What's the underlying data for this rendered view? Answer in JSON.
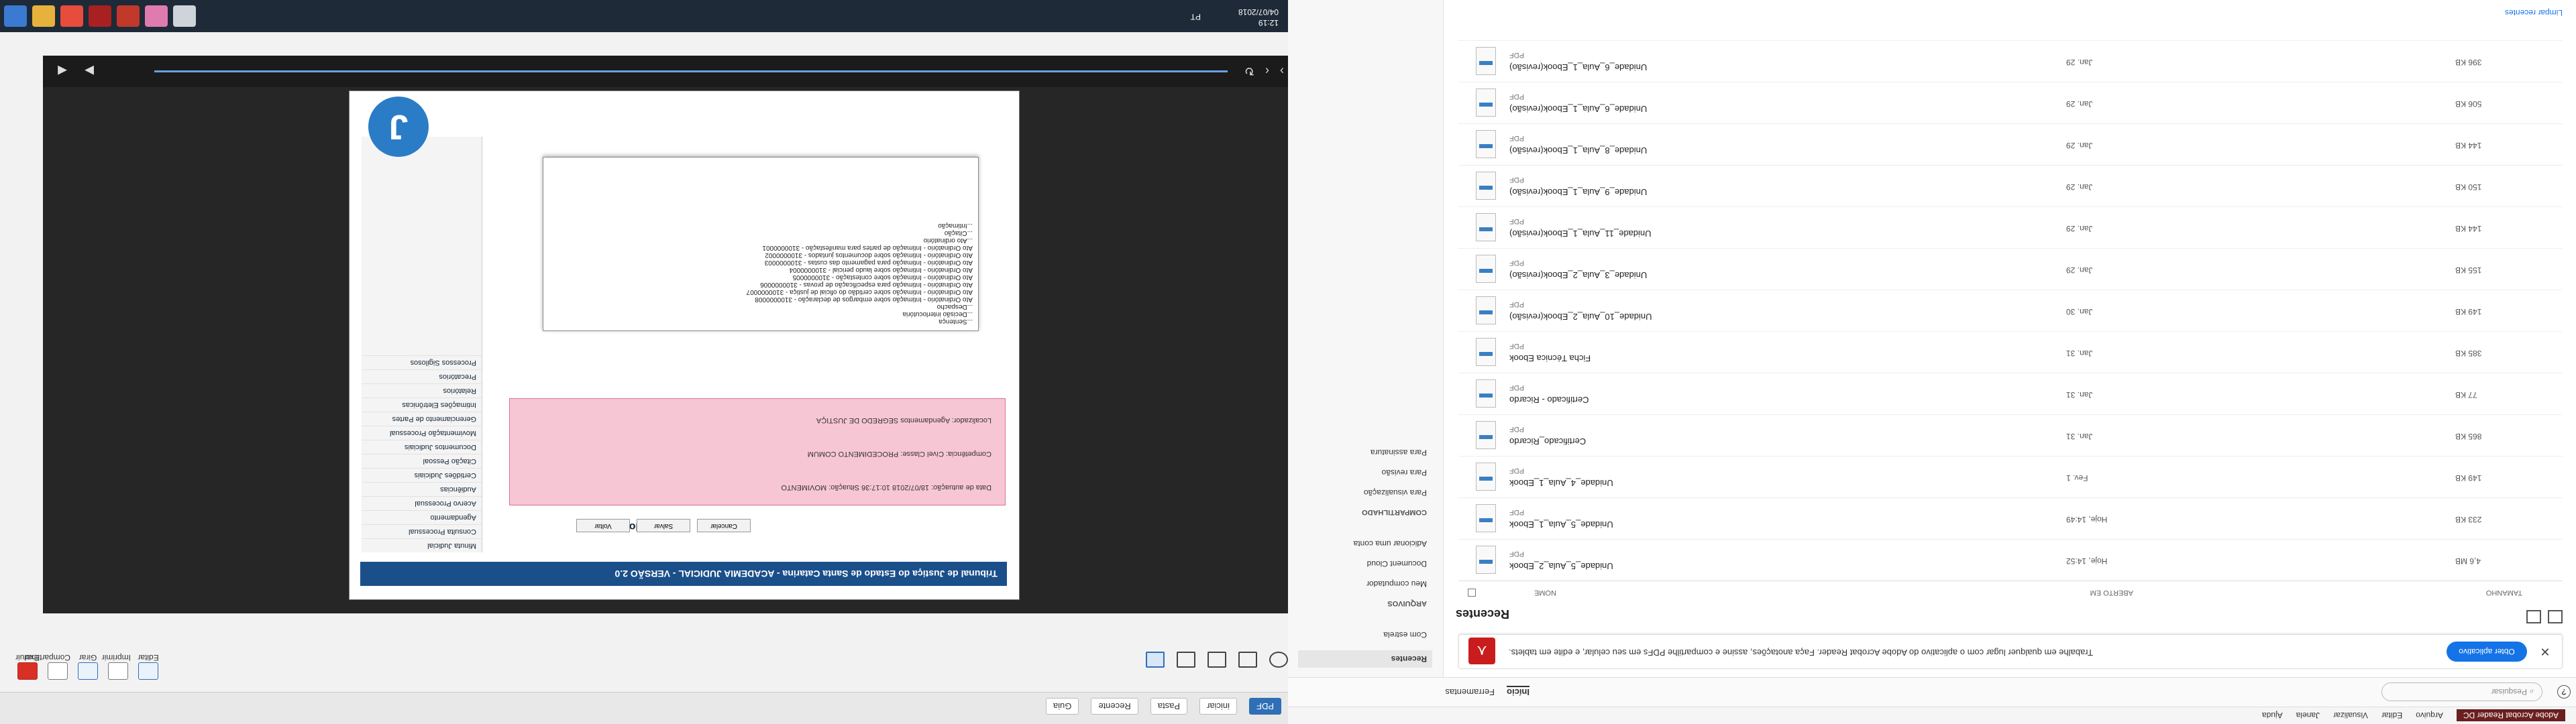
{
  "left": {
    "taskbar": {
      "time": "12:19",
      "date": "04/07/2018",
      "lang": "PT"
    },
    "tabs": [
      "PDF",
      "iniciar",
      "Pasta",
      "Recente",
      "Guia"
    ],
    "tools": [
      "Excluir",
      "Compartilhar",
      "Girar",
      "Imprimir",
      "Editar"
    ],
    "doc": {
      "header": "Tribunal de Justiça do Estado de Santa Catarina - ACADEMIA JUDICIAL - VERSÃO 2.0",
      "title": "Nova Minuta",
      "badge": "J",
      "pink_lines": [
        "Localizador: Agendamentos  SEGREDO DE JUSTIÇA",
        "Competência: Cível   Classe: PROCEDIMENTO COMUM",
        "Data de autuação: 18/07/2018 10:17:36   Situação: MOVIMENTO"
      ],
      "buttons": [
        "Voltar",
        "Salvar",
        "Cancelar"
      ],
      "sidebar_items": [
        "Minuta Judicial",
        "Consulta Processual",
        "Agendamento",
        "Acervo Processual",
        "Audiências",
        "Certidões Judiciais",
        "Citação Pessoal",
        "Documentos Judiciais",
        "Movimentação Processual",
        "Gerenciamento de Partes",
        "Intimações Eletrônicas",
        "Relatórios",
        "Precatórios",
        "Processos Sigilosos"
      ],
      "dropdown_options": [
        "...Intimação",
        "...Citação",
        "...Ato ordinatório",
        "Ato Ordinatório - Intimação de partes para manifestação - 3100000001",
        "Ato Ordinatório - Intimação sobre documentos juntados - 3100000002",
        "Ato Ordinatório - Intimação para pagamento das custas - 3100000003",
        "Ato Ordinatório - Intimação sobre laudo pericial - 3100000004",
        "Ato Ordinatório - Intimação sobre contestação - 3100000005",
        "Ato Ordinatório - Intimação para especificação de provas - 3100000006",
        "Ato Ordinatório - Intimação sobre certidão do oficial de justiça - 3100000007",
        "Ato Ordinatório - Intimação sobre embargos de declaração - 3100000008",
        "...Despacho",
        "...Decisão interlocutória",
        "...Sentença"
      ]
    }
  },
  "right": {
    "menubar": {
      "title": "Adobe Acrobat Reader DC",
      "items": [
        "Arquivo",
        "Editar",
        "Visualizar",
        "Janela",
        "Ajuda"
      ]
    },
    "nav_tabs": [
      "Início",
      "Ferramentas"
    ],
    "search_placeholder": "Pesquisar",
    "sidebar": {
      "items": [
        "Recentes",
        "Com estrela",
        "Meu computador",
        "Document Cloud",
        "Adicionar uma conta"
      ],
      "shared_head": "COMPARTILHADO",
      "shared_items": [
        "Para visualização",
        "Para revisão",
        "Para assinatura"
      ]
    },
    "banner": {
      "text": "Trabalhe em qualquer lugar com o aplicativo do Adobe Acrobat Reader. Faça anotações, assine e compartilhe PDFs em seu celular, e edite em tablets.",
      "cta": "Obter aplicativo"
    },
    "heading": "Recentes",
    "columns": [
      "NOME",
      "ABERTO EM",
      "TAMANHO"
    ],
    "files": [
      {
        "name": "Unidade_5_Aula_2_Ebook",
        "kind": "PDF",
        "date": "Hoje, 14:52",
        "size": "4,6 MB"
      },
      {
        "name": "Unidade_5_Aula_1_Ebook",
        "kind": "PDF",
        "date": "Hoje, 14:49",
        "size": "233 KB"
      },
      {
        "name": "Unidade_4_Aula_1_Ebook",
        "kind": "PDF",
        "date": "Fev. 1",
        "size": "149 KB"
      },
      {
        "name": "Certificado_Ricardo",
        "kind": "PDF",
        "date": "Jan. 31",
        "size": "865 KB"
      },
      {
        "name": "Certificado - Ricardo",
        "kind": "PDF",
        "date": "Jan. 31",
        "size": "77 KB"
      },
      {
        "name": "Ficha Técnica Ebook",
        "kind": "PDF",
        "date": "Jan. 31",
        "size": "385 KB"
      },
      {
        "name": "Unidade_10_Aula_2_Ebook(revisão)",
        "kind": "PDF",
        "date": "Jan. 30",
        "size": "149 KB"
      },
      {
        "name": "Unidade_3_Aula_2_Ebook(revisão)",
        "kind": "PDF",
        "date": "Jan. 29",
        "size": "155 KB"
      },
      {
        "name": "Unidade_11_Aula_1_Ebook(revisão)",
        "kind": "PDF",
        "date": "Jan. 29",
        "size": "144 KB"
      },
      {
        "name": "Unidade_9_Aula_1_Ebook(revisão)",
        "kind": "PDF",
        "date": "Jan. 29",
        "size": "150 KB"
      },
      {
        "name": "Unidade_8_Aula_1_Ebook(revisão)",
        "kind": "PDF",
        "date": "Jan. 29",
        "size": "144 KB"
      },
      {
        "name": "Unidade_6_Aula_1_Ebook(revisão)",
        "kind": "PDF",
        "date": "Jan. 29",
        "size": "506 KB"
      },
      {
        "name": "Unidade_6_Aula_1_Ebook(revisão)",
        "kind": "PDF",
        "date": "Jan. 29",
        "size": "396 KB"
      }
    ],
    "clear": "Limpar recentes"
  }
}
